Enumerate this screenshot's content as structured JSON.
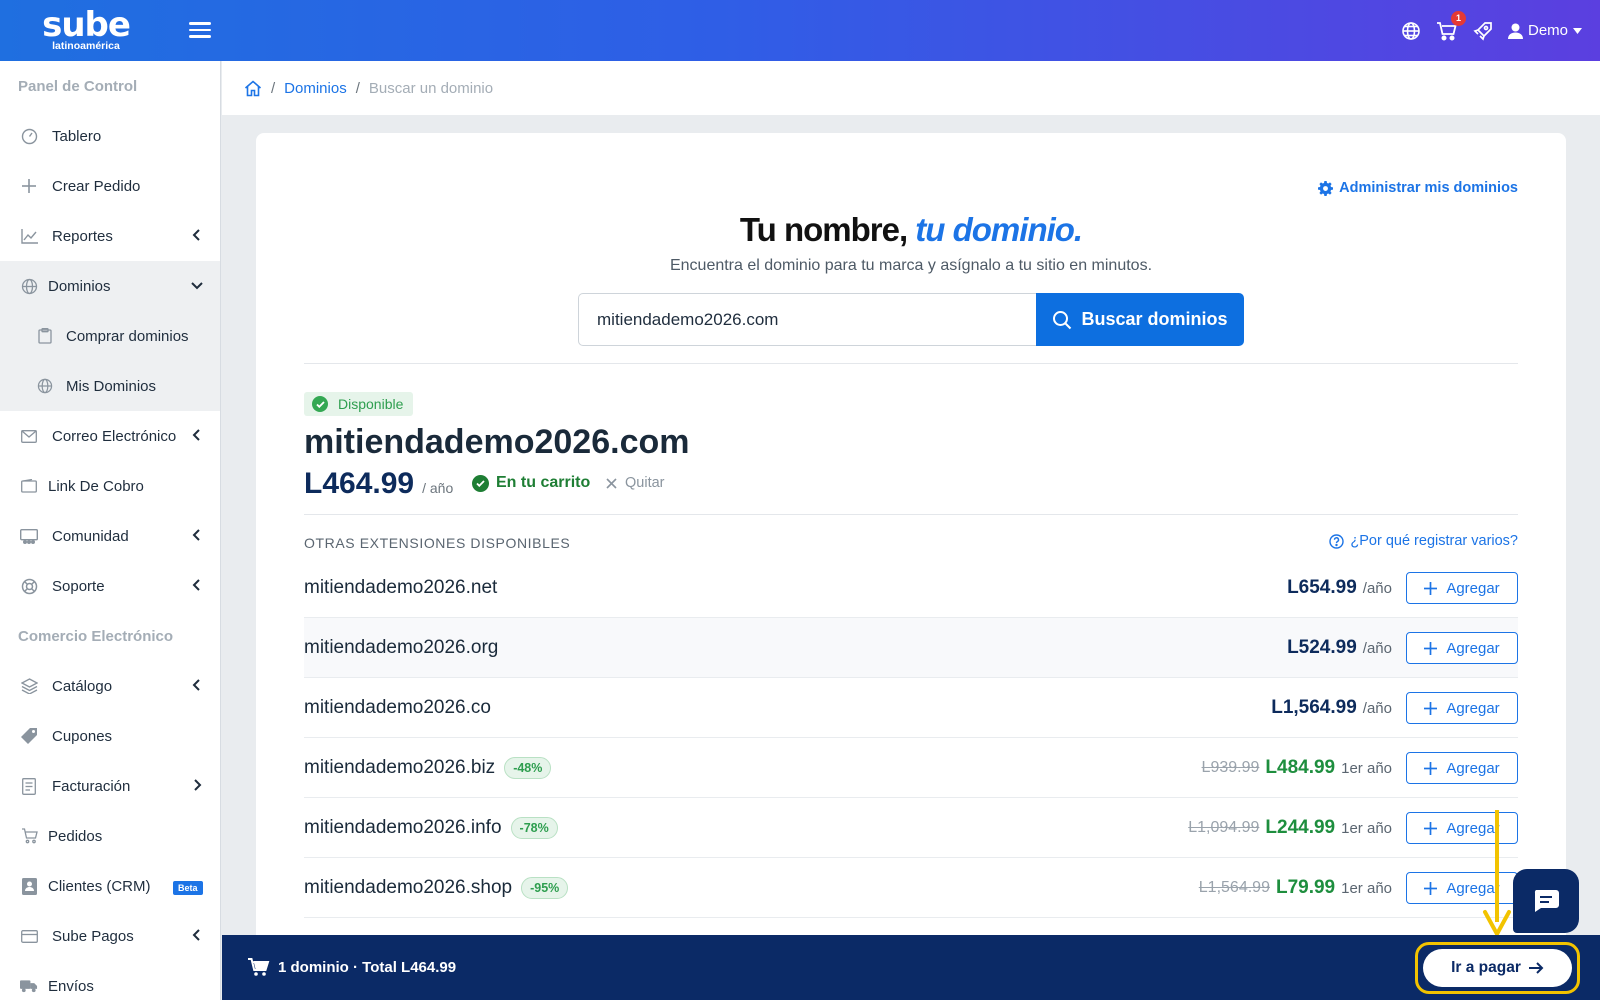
{
  "header": {
    "logo_text": "sube",
    "logo_sub": "latinoamérica",
    "cart_count": "1",
    "user_name": "Demo"
  },
  "sidebar": {
    "section1": "Panel de Control",
    "section2": "Comercio Electrónico",
    "items": [
      {
        "label": "Tablero"
      },
      {
        "label": "Crear Pedido"
      },
      {
        "label": "Reportes"
      },
      {
        "label": "Dominios"
      },
      {
        "label": "Comprar dominios"
      },
      {
        "label": "Mis Dominios"
      },
      {
        "label": "Correo Electrónico"
      },
      {
        "label": "Link De Cobro"
      },
      {
        "label": "Comunidad"
      },
      {
        "label": "Soporte"
      },
      {
        "label": "Catálogo"
      },
      {
        "label": "Cupones"
      },
      {
        "label": "Facturación"
      },
      {
        "label": "Pedidos"
      },
      {
        "label": "Clientes (CRM)"
      },
      {
        "label": "Sube Pagos"
      },
      {
        "label": "Envíos"
      }
    ],
    "beta_label": "Beta"
  },
  "breadcrumb": {
    "level1": "Dominios",
    "current": "Buscar un dominio"
  },
  "main": {
    "manage_link": "Administrar mis dominios",
    "title_part1": "Tu nombre,",
    "title_part2": "tu dominio.",
    "subtitle": "Encuentra el dominio para tu marca y asígnalo a tu sitio en minutos.",
    "search_value": "mitiendademo2026.com",
    "search_button": "Buscar dominios",
    "status_badge": "Disponible",
    "domain": "mitiendademo2026.com",
    "price": "L464.99",
    "per_year": "/ año",
    "in_cart": "En tu carrito",
    "remove": "Quitar",
    "others_header": "OTRAS EXTENSIONES DISPONIBLES",
    "why_link": "¿Por qué registrar varios?"
  },
  "extensions": [
    {
      "domain": "mitiendademo2026.net",
      "discount": "",
      "old": "",
      "price": "L654.99",
      "per": "/año",
      "promo": false
    },
    {
      "domain": "mitiendademo2026.org",
      "discount": "",
      "old": "",
      "price": "L524.99",
      "per": "/año",
      "promo": false
    },
    {
      "domain": "mitiendademo2026.co",
      "discount": "",
      "old": "",
      "price": "L1,564.99",
      "per": "/año",
      "promo": false
    },
    {
      "domain": "mitiendademo2026.biz",
      "discount": "-48%",
      "old": "L939.99",
      "price": "L484.99",
      "per": "1er año",
      "promo": true
    },
    {
      "domain": "mitiendademo2026.info",
      "discount": "-78%",
      "old": "L1,094.99",
      "price": "L244.99",
      "per": "1er año",
      "promo": true
    },
    {
      "domain": "mitiendademo2026.shop",
      "discount": "-95%",
      "old": "L1,564.99",
      "price": "L79.99",
      "per": "1er año",
      "promo": true
    }
  ],
  "add_label": "Agregar",
  "cart_bar": {
    "summary": "1 dominio · Total L464.99",
    "pay_button": "Ir a pagar"
  },
  "colors": {
    "accent": "#1c74e6",
    "cart_bar": "#0b2a66",
    "promo_green": "#1e8e3e",
    "highlight": "#f2c300"
  }
}
